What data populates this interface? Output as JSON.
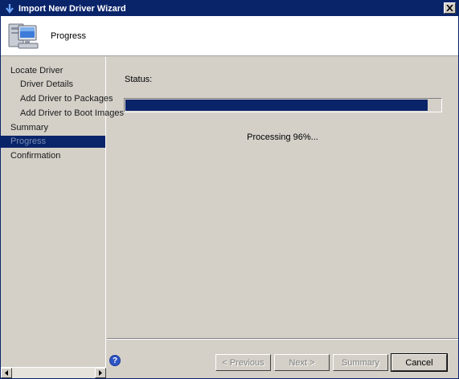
{
  "window": {
    "title": "Import New Driver Wizard",
    "colors": {
      "titlebar": "#0a246a",
      "accent": "#0a246a",
      "face": "#d4d0c8"
    }
  },
  "header": {
    "title": "Progress",
    "icon": "computer-icon"
  },
  "sidebar": {
    "items": [
      {
        "label": "Locate Driver",
        "indent": 0,
        "active": false
      },
      {
        "label": "Driver Details",
        "indent": 1,
        "active": false
      },
      {
        "label": "Add Driver to Packages",
        "indent": 1,
        "active": false
      },
      {
        "label": "Add Driver to Boot Images",
        "indent": 1,
        "active": false
      },
      {
        "label": "Summary",
        "indent": 0,
        "active": false
      },
      {
        "label": "Progress",
        "indent": 0,
        "active": true
      },
      {
        "label": "Confirmation",
        "indent": 0,
        "active": false
      }
    ]
  },
  "main": {
    "status_label": "Status:",
    "progress_percent": 96,
    "processing_text": "Processing 96%..."
  },
  "footer": {
    "previous_label": "< Previous",
    "next_label": "Next >",
    "summary_label": "Summary",
    "cancel_label": "Cancel"
  }
}
